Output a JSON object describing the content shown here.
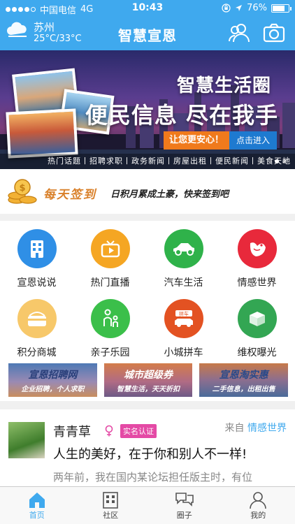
{
  "status_bar": {
    "carrier": "中国电信",
    "network": "4G",
    "time": "10:43",
    "battery": "76%",
    "battery_level": 0.76
  },
  "header": {
    "city": "苏州",
    "temperature": "25°C/33°C",
    "title": "智慧宣恩",
    "icons": [
      "users-icon",
      "camera-icon"
    ]
  },
  "banner": {
    "line1": "智慧生活圈",
    "line2": "便民信息 尽在我手",
    "cta_left": "让您更安心！",
    "cta_right": "点击进入",
    "tagline": "热门话题丨招聘求职丨政务新闻丨房屋出租丨便民新闻丨美食天地"
  },
  "signin": {
    "title": "每天签到",
    "slogan": "日积月累成土豪，快来签到吧"
  },
  "grid": [
    {
      "label": "宣恩说说",
      "icon": "building-icon",
      "color": "#2f8fe6"
    },
    {
      "label": "热门直播",
      "icon": "tv-icon",
      "color": "#f5a623"
    },
    {
      "label": "汽车生活",
      "icon": "car-icon",
      "color": "#2fb24a"
    },
    {
      "label": "情感世界",
      "icon": "bird-icon",
      "color": "#e8293b"
    },
    {
      "label": "积分商城",
      "icon": "wallet-icon",
      "color": "#f7c86a"
    },
    {
      "label": "亲子乐园",
      "icon": "family-icon",
      "color": "#3bbf4a"
    },
    {
      "label": "小城拼车",
      "icon": "carpool-icon",
      "color": "#e35222"
    },
    {
      "label": "维权曝光",
      "icon": "box-icon",
      "color": "#33a653"
    }
  ],
  "promos": [
    {
      "title": "宣恩招聘网",
      "sub": "企业招聘，个人求职"
    },
    {
      "title": "城市超级券",
      "sub": "智慧生活，天天折扣"
    },
    {
      "title": "宣恩淘实惠",
      "sub": "二手信息，出租出售"
    }
  ],
  "post": {
    "name": "青青草",
    "badge": "实名认证",
    "from_prefix": "来自",
    "from_source": "情感世界",
    "headline": "人生的美好，在于你和别人不一样!",
    "excerpt": "两年前，我在国内某论坛担任版主时，有位"
  },
  "tabs": [
    {
      "label": "首页",
      "icon": "home-icon",
      "active": true
    },
    {
      "label": "社区",
      "icon": "building-icon",
      "active": false
    },
    {
      "label": "圈子",
      "icon": "chat-icon",
      "active": false
    },
    {
      "label": "我的",
      "icon": "user-icon",
      "active": false
    }
  ]
}
